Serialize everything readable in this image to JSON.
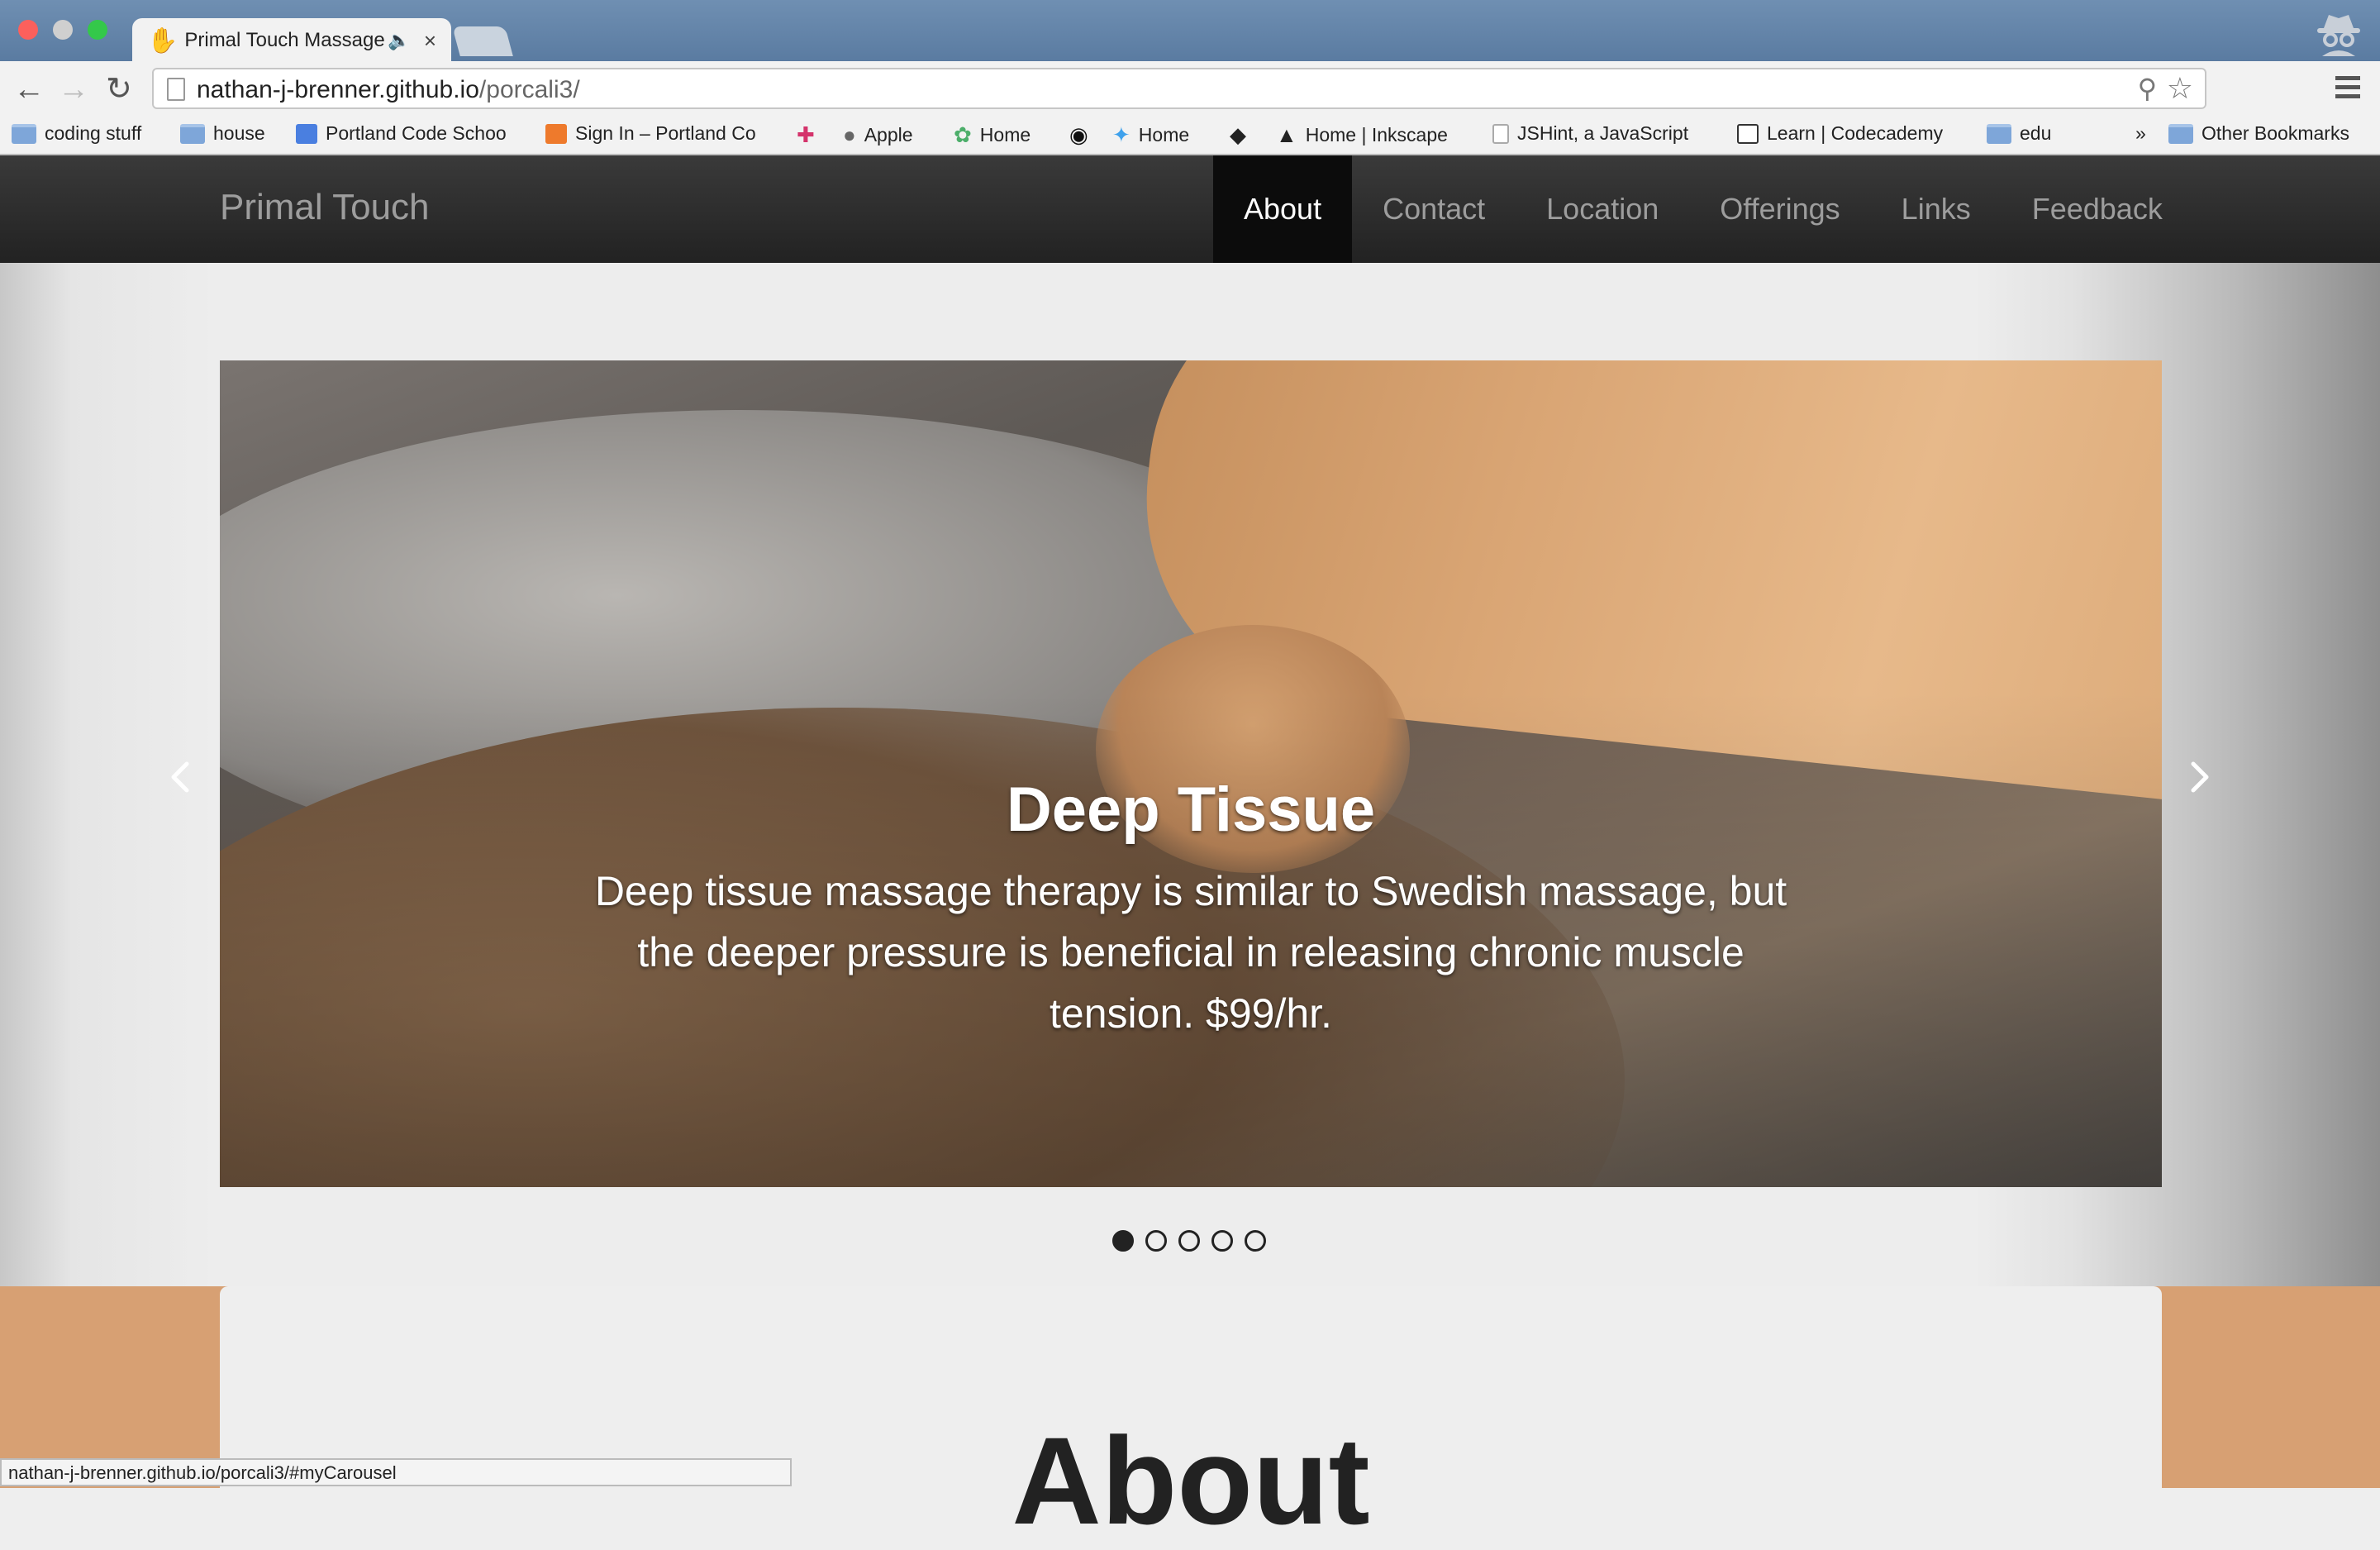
{
  "browser": {
    "tab_title": "Primal Touch Massage",
    "url_host": "nathan-j-brenner.github.io",
    "url_path": "/porcali3/",
    "bookmarks": [
      {
        "label": "coding stuff",
        "icon": "folder-icon"
      },
      {
        "label": "house",
        "icon": "folder-icon"
      },
      {
        "label": "Portland Code Schoo",
        "icon": "google-icon"
      },
      {
        "label": "Sign In – Portland Co",
        "icon": "h-icon"
      },
      {
        "label": "",
        "icon": "slack-icon"
      },
      {
        "label": "Apple",
        "icon": "apple-icon"
      },
      {
        "label": "Home",
        "icon": "leaf-icon"
      },
      {
        "label": "",
        "icon": "github-icon"
      },
      {
        "label": "Home",
        "icon": "twitter-icon"
      },
      {
        "label": "",
        "icon": "gem-icon"
      },
      {
        "label": "Home | Inkscape",
        "icon": "inkscape-icon"
      },
      {
        "label": "JSHint, a JavaScript",
        "icon": "page-icon"
      },
      {
        "label": "Learn | Codecademy",
        "icon": "codecademy-icon"
      },
      {
        "label": "edu",
        "icon": "folder-icon"
      }
    ],
    "overflow_label": "»",
    "other_bookmarks": "Other Bookmarks",
    "status_url": "nathan-j-brenner.github.io/porcali3/#myCarousel"
  },
  "site": {
    "brand": "Primal Touch",
    "nav": [
      {
        "label": "About",
        "active": true
      },
      {
        "label": "Contact",
        "active": false
      },
      {
        "label": "Location",
        "active": false
      },
      {
        "label": "Offerings",
        "active": false
      },
      {
        "label": "Links",
        "active": false
      },
      {
        "label": "Feedback",
        "active": false
      }
    ]
  },
  "carousel": {
    "heading": "Deep Tissue",
    "text": "Deep tissue massage therapy is similar to Swedish massage, but the deeper pressure is beneficial in releasing chronic muscle tension. $99/hr.",
    "slide_count": 5,
    "active_index": 0
  },
  "about": {
    "heading": "About"
  },
  "colors": {
    "nav_bg": "#222222",
    "nav_active": "#0c0c0c",
    "accent_band": "#d7a073"
  }
}
